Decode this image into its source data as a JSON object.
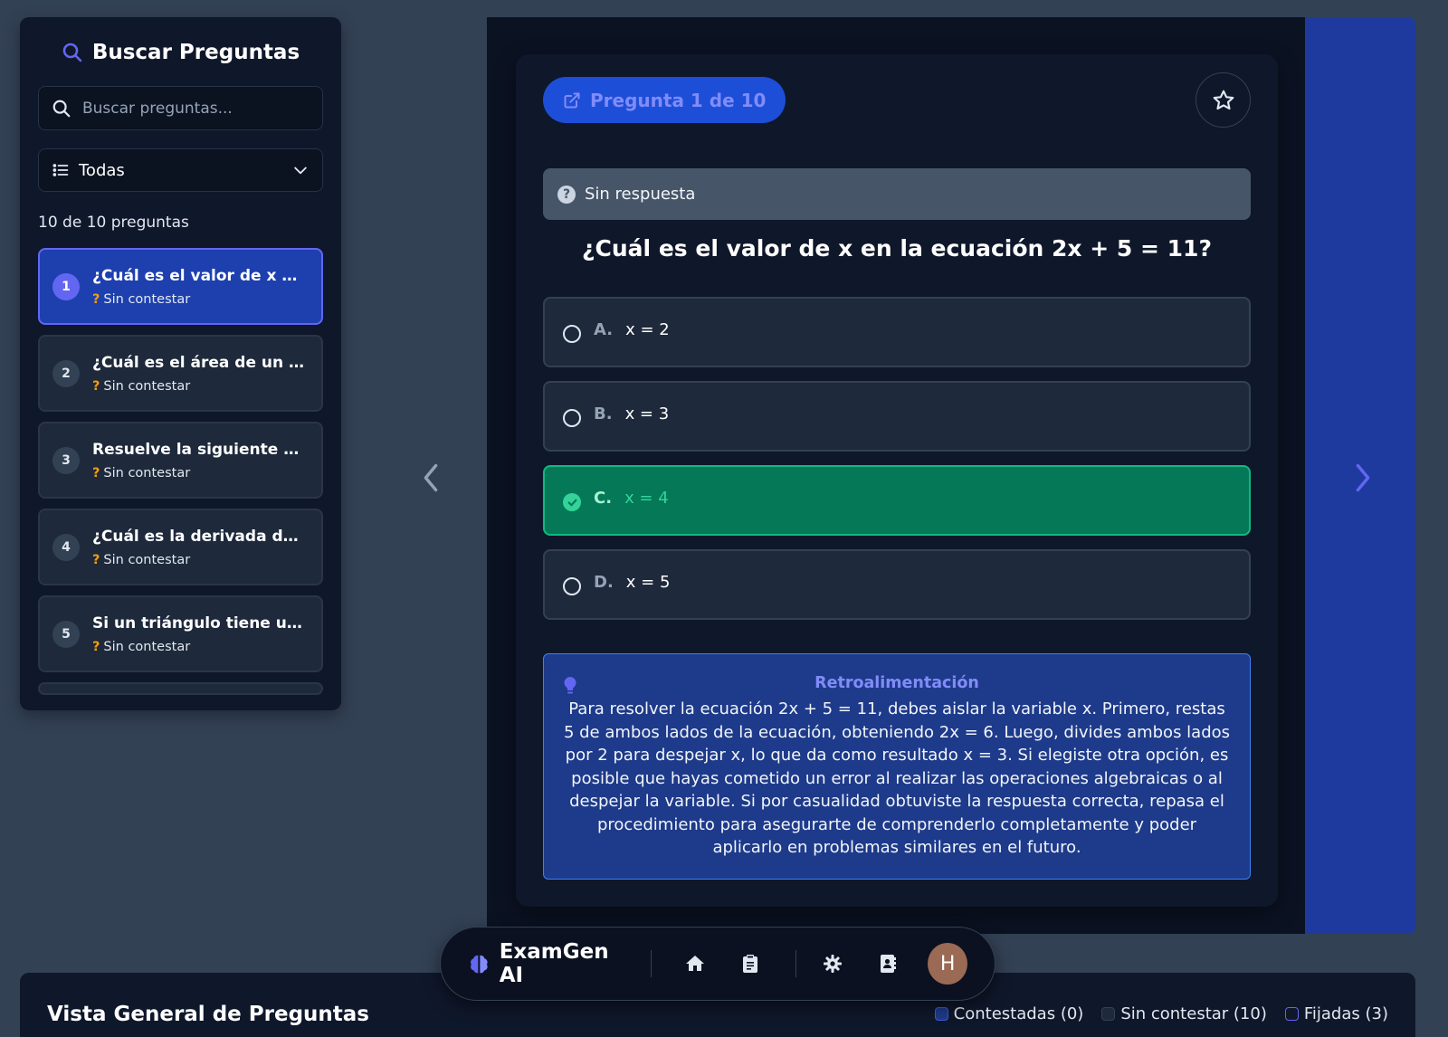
{
  "sidebar": {
    "title": "Buscar Preguntas",
    "search_placeholder": "Buscar preguntas...",
    "filter_value": "Todas",
    "count_text": "10 de 10 preguntas",
    "items": [
      {
        "num": "1",
        "title": "¿Cuál es el valor de x en ...",
        "status": "Sin contestar",
        "active": true
      },
      {
        "num": "2",
        "title": "¿Cuál es el área de un re...",
        "status": "Sin contestar",
        "active": false
      },
      {
        "num": "3",
        "title": "Resuelve la siguiente ec...",
        "status": "Sin contestar",
        "active": false
      },
      {
        "num": "4",
        "title": "¿Cuál es la derivada de l...",
        "status": "Sin contestar",
        "active": false
      },
      {
        "num": "5",
        "title": "Si un triángulo tiene una ...",
        "status": "Sin contestar",
        "active": false
      }
    ]
  },
  "question_card": {
    "pill_label": "Pregunta 1 de 10",
    "status_label": "Sin respuesta",
    "question_text": "¿Cuál es el valor de x en la ecuación 2x + 5 = 11?",
    "options": [
      {
        "letter": "A.",
        "text": "x = 2",
        "correct": false
      },
      {
        "letter": "B.",
        "text": "x = 3",
        "correct": false
      },
      {
        "letter": "C.",
        "text": "x = 4",
        "correct": true
      },
      {
        "letter": "D.",
        "text": "x = 5",
        "correct": false
      }
    ],
    "feedback_title": "Retroalimentación",
    "feedback_text": "Para resolver la ecuación 2x + 5 = 11, debes aislar la variable x. Primero, restas 5 de ambos lados de la ecuación, obteniendo 2x = 6. Luego, divides ambos lados por 2 para despejar x, lo que da como resultado x = 3. Si elegiste otra opción, es posible que hayas cometido un error al realizar las operaciones algebraicas o al despejar la variable. Si por casualidad obtuviste la respuesta correcta, repasa el procedimiento para asegurarte de comprenderlo completamente y poder aplicarlo en problemas similares en el futuro."
  },
  "dock": {
    "brand": "ExamGen AI",
    "avatar_initial": "H"
  },
  "overview": {
    "title": "Vista General de Preguntas",
    "legend": [
      {
        "label": "Contestadas (0)",
        "color": "#1e3a8a",
        "border": "#3b5bdb"
      },
      {
        "label": "Sin contestar (10)",
        "color": "#1e293b",
        "border": "#334155"
      },
      {
        "label": "Fijadas (3)",
        "color": "transparent",
        "border": "#6366f1"
      }
    ]
  },
  "colors": {
    "accent": "#6366f1",
    "correct": "#047857",
    "feedback_bg": "#1e3a8a"
  }
}
